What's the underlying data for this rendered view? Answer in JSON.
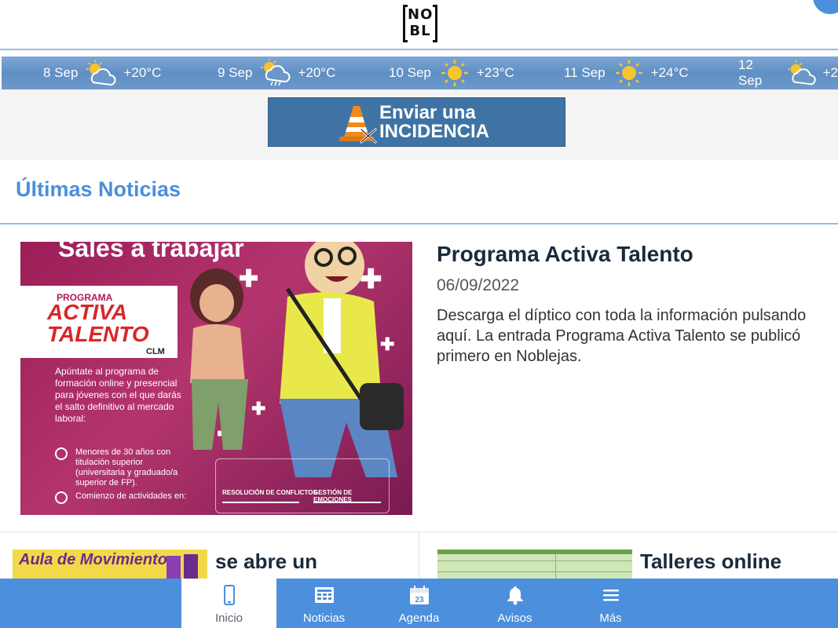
{
  "header": {
    "logo_text_top": "NO",
    "logo_text_bottom": "BL"
  },
  "weather": [
    {
      "date": "8 Sep",
      "icon": "partly-cloudy-icon",
      "temp": "+20°C"
    },
    {
      "date": "9 Sep",
      "icon": "rain-cloud-icon",
      "temp": "+20°C"
    },
    {
      "date": "10 Sep",
      "icon": "sun-icon",
      "temp": "+23°C"
    },
    {
      "date": "11 Sep",
      "icon": "sun-icon",
      "temp": "+24°C"
    },
    {
      "date": "12 Sep",
      "icon": "partly-cloudy-icon",
      "temp": "+2"
    }
  ],
  "incidence_banner": {
    "line1": "Enviar una",
    "line2": "INCIDENCIA"
  },
  "section": {
    "title": "Últimas Noticias"
  },
  "featured": {
    "title": "Programa Activa Talento",
    "date": "06/09/2022",
    "excerpt": "Descarga el díptico con toda la información pulsando aquí. La entrada Programa Activa Talento se publicó primero en Noblejas.",
    "poster": {
      "headline": "Sales a trabajar",
      "programa": "PROGRAMA",
      "activa": "ACTIVA",
      "talento": "TALENTO",
      "clm": "CLM",
      "body": "Apúntate al programa de formación online y presencial para jóvenes con el que darás el salto definitivo al mercado laboral:",
      "bullet1": "Menores de 30 años con titulación superior (universitaria y graduado/a superior de FP).",
      "bullet2": "Comienzo de actividades en:",
      "panel_left": "RESOLUCIÓN DE CONFLICTOS",
      "panel_right": "GESTIÓN DE EMOCIONES"
    }
  },
  "cards": [
    {
      "title": "se abre un",
      "thumb_text": "Aula de Movimiento"
    },
    {
      "title": "Talleres online"
    }
  ],
  "bottom_nav": [
    {
      "label": "Inicio",
      "icon": "phone-icon",
      "active": true
    },
    {
      "label": "Noticias",
      "icon": "newspaper-icon",
      "active": false
    },
    {
      "label": "Agenda",
      "icon": "calendar-icon",
      "calendar_day": "23",
      "active": false
    },
    {
      "label": "Avisos",
      "icon": "bell-icon",
      "active": false
    },
    {
      "label": "Más",
      "icon": "menu-icon",
      "active": false
    }
  ],
  "colors": {
    "accent": "#4b8fdd",
    "banner": "#3f73a3",
    "poster": "#a82a62"
  }
}
